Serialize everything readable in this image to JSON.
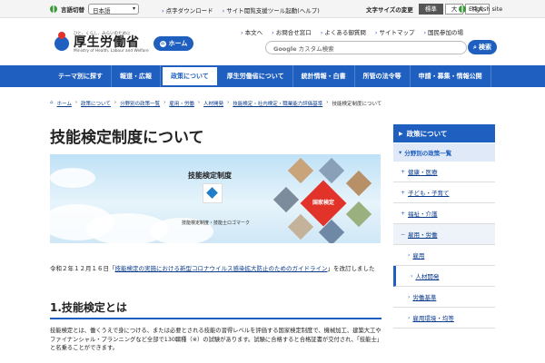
{
  "util": {
    "lang_label": "言語切替",
    "lang_value": "日本語",
    "links": [
      "点字ダウンロード",
      "サイト閲覧支援ツール起動",
      "(ヘルプ)"
    ],
    "font_label": "文字サイズの変更",
    "font_sizes": [
      "標準",
      "大",
      "特大"
    ],
    "english": "English site"
  },
  "header": {
    "tagline": "ひと、くらし、みらいのために",
    "org": "厚生労働省",
    "org_en": "Ministry of Health, Labour and Welfare",
    "home": "ホーム",
    "links": [
      "本文へ",
      "お問合せ窓口",
      "よくある御質問",
      "サイトマップ",
      "国民参加の場"
    ],
    "search_brand": "Google",
    "search_placeholder": "カスタム検索",
    "search_button": "検索"
  },
  "gnav": [
    "テーマ別に探す",
    "報道・広報",
    "政策について",
    "厚生労働省について",
    "統計情報・白書",
    "所管の法令等",
    "申請・募集・情報公開"
  ],
  "breadcrumb": [
    "ホーム",
    "政策について",
    "分野別の政策一覧",
    "雇用・労働",
    "人材開発",
    "技能検定・社内検定・職業能力評価基準",
    "技能検定制度について"
  ],
  "main": {
    "title": "技能検定制度について",
    "banner_title": "技能検定制度",
    "banner_sub": "技能検定制度・技能士ロゴマーク",
    "banner_badge": "国家検定",
    "notice_prefix": "令和２年１２月１６日「",
    "notice_link": "技能検定の実施における新型コロナウイルス感染拡大防止のためのガイドライン",
    "notice_suffix": "」を改訂しました",
    "section1": "1.技能検定とは",
    "body": "技能検定とは、働くうえで身につける、または必要とされる技能の習得レベルを評価する国家検定制度で、機械加工、建築大工やファイナンシャル・プランニングなど全部で130職種（※）の試験があります。試験に合格すると合格証書が交付され、「技能士」と名乗ることができます。"
  },
  "sidebar": {
    "head": "政策について",
    "sub": "分野別の政策一覧",
    "items": [
      "健康・医療",
      "子ども・子育て",
      "福祉・介護",
      "雇用・労働",
      "雇用",
      "人材開発",
      "労働基準",
      "雇用環境・均等"
    ]
  },
  "colors": {
    "primary": "#1f5fbf",
    "accent": "#e2332b"
  }
}
